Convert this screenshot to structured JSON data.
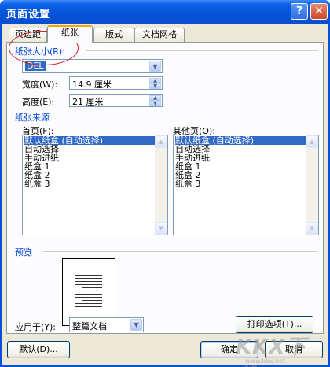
{
  "window": {
    "title": "页面设置",
    "help_glyph": "?",
    "close_glyph": "✕"
  },
  "tabs": [
    {
      "label": "页边距",
      "active": false
    },
    {
      "label": "纸张",
      "active": true
    },
    {
      "label": "版式",
      "active": false
    },
    {
      "label": "文档网格",
      "active": false
    }
  ],
  "paper_size": {
    "group_label": "纸张大小(R):",
    "selected": "DEL",
    "width_label": "宽度(W):",
    "width_value": "14.9 厘米",
    "height_label": "高度(E):",
    "height_value": "21 厘米"
  },
  "paper_source": {
    "group_label": "纸张来源",
    "first_page_label": "首页(F):",
    "other_pages_label": "其他页(O):",
    "first_page_items": [
      "默认纸盒 (自动选择)",
      "自动选择",
      "手动进纸",
      "纸盒 1",
      "纸盒 2",
      "纸盒 3"
    ],
    "other_pages_items": [
      "默认纸盒 (自动选择)",
      "自动选择",
      "手动进纸",
      "纸盒 1",
      "纸盒 2",
      "纸盒 3"
    ],
    "selected_index": 0
  },
  "preview": {
    "group_label": "预览"
  },
  "apply_to": {
    "label": "应用于(Y):",
    "selected": "整篇文档"
  },
  "buttons": {
    "print_options": "打印选项(T)...",
    "default": "默认(D)...",
    "ok": "确定",
    "cancel": "取消"
  },
  "watermark": {
    "text": "KKX下载",
    "url": "www.kkx.net"
  },
  "colors": {
    "title_bar": "#0553d8",
    "group_label": "#0046d5",
    "selection": "#316ac5",
    "annotation_circle": "#d21d1d",
    "dialog_bg": "#ece9d8"
  }
}
